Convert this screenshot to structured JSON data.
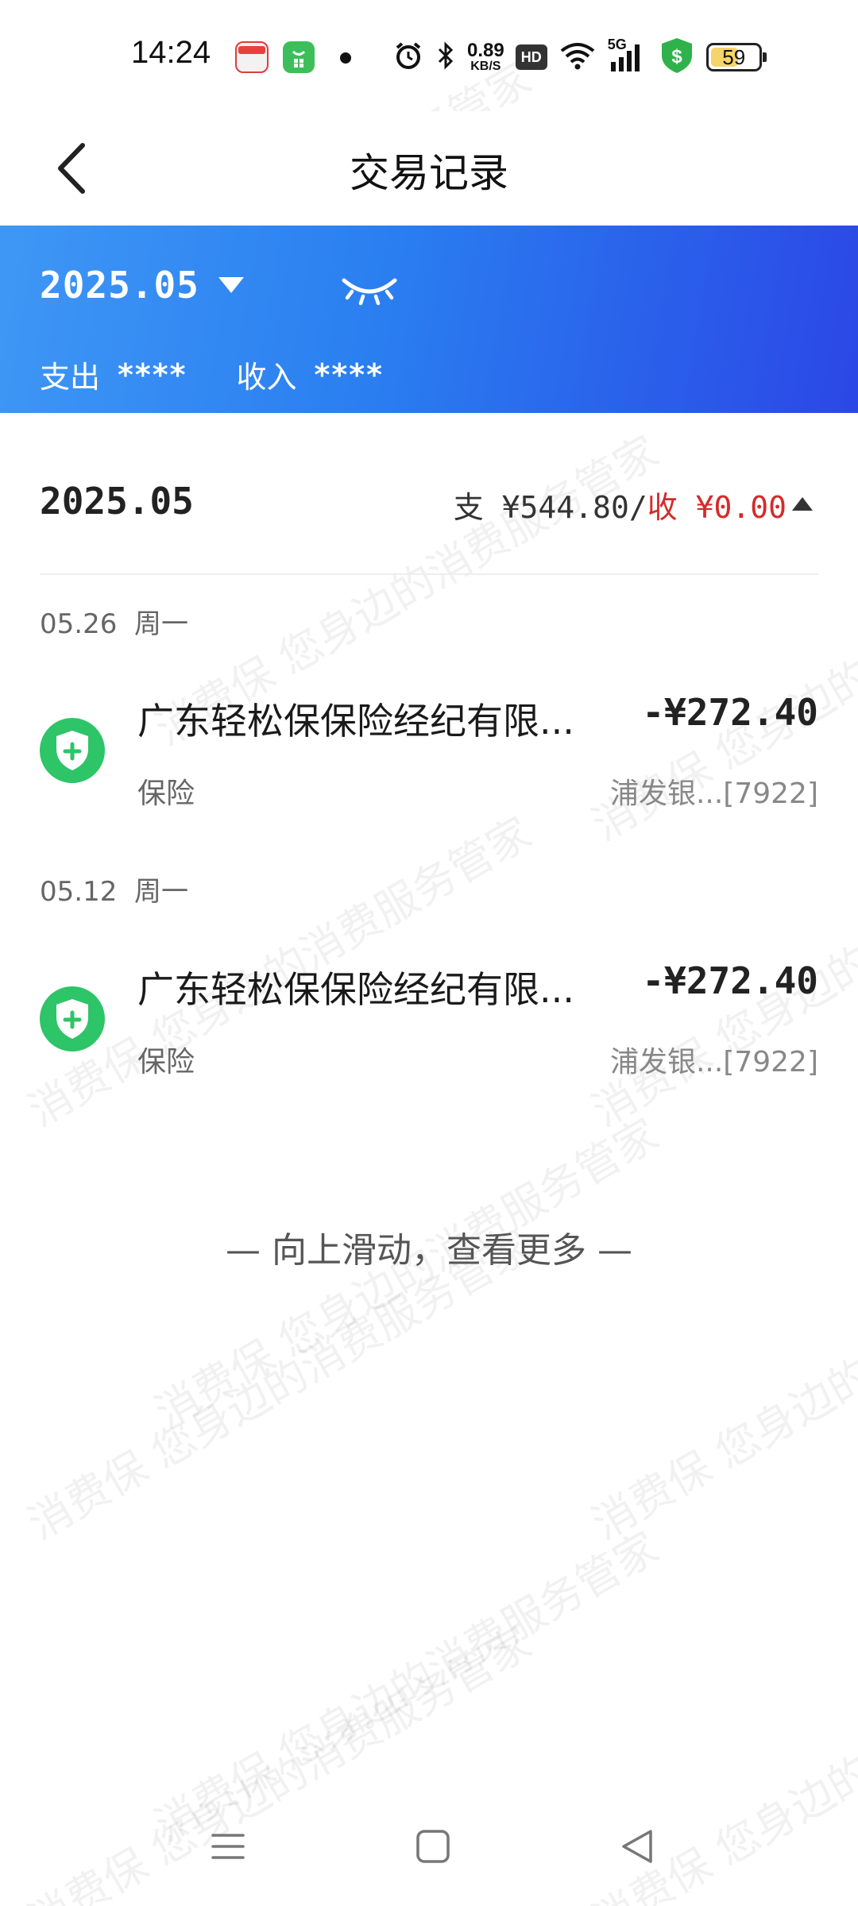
{
  "status_bar": {
    "time": "14:24",
    "net_speed_value": "0.89",
    "net_speed_unit": "KB/S",
    "hd_label": "HD",
    "signal_label": "5G",
    "battery_level": "59",
    "battery_fraction": 0.59,
    "icons": [
      "news-app-icon",
      "shopping-app-icon",
      "notification-dot-icon",
      "alarm-icon",
      "bluetooth-icon",
      "hd-icon",
      "wifi-icon",
      "signal-5g-icon",
      "security-shield-icon",
      "battery-icon"
    ]
  },
  "header": {
    "back_icon": "chevron-left-icon",
    "title": "交易记录"
  },
  "banner": {
    "month": "2025.05",
    "dropdown_icon": "caret-down-icon",
    "visibility_icon": "eye-closed-icon",
    "expense_label": "支出",
    "expense_value": "****",
    "income_label": "收入",
    "income_value": "****",
    "gradient_start": "#3f97f5",
    "gradient_end": "#2b47e6"
  },
  "month_section": {
    "label": "2025.05",
    "expense_prefix": "支 ",
    "expense_total": "¥544.80",
    "separator": "/",
    "income_prefix": "收 ",
    "income_total": "¥0.00",
    "collapse_icon": "caret-up-icon",
    "income_color": "#d62a2a"
  },
  "groups": [
    {
      "date": "05.26",
      "weekday": "周一",
      "transactions": [
        {
          "icon": "insurance-shield-icon",
          "icon_color": "#2ec468",
          "merchant": "广东轻松保保险经纪有限...",
          "amount": "-¥272.40",
          "category": "保险",
          "account": "浦发银...[7922]"
        }
      ]
    },
    {
      "date": "05.12",
      "weekday": "周一",
      "transactions": [
        {
          "icon": "insurance-shield-icon",
          "icon_color": "#2ec468",
          "merchant": "广东轻松保保险经纪有限...",
          "amount": "-¥272.40",
          "category": "保险",
          "account": "浦发银...[7922]"
        }
      ]
    }
  ],
  "load_more": "— 向上滑动，查看更多 —",
  "watermark_text": "消费保 您身边的消费服务管家",
  "nav_bar": {
    "icons": [
      "menu-icon",
      "home-square-icon",
      "back-triangle-icon"
    ]
  }
}
